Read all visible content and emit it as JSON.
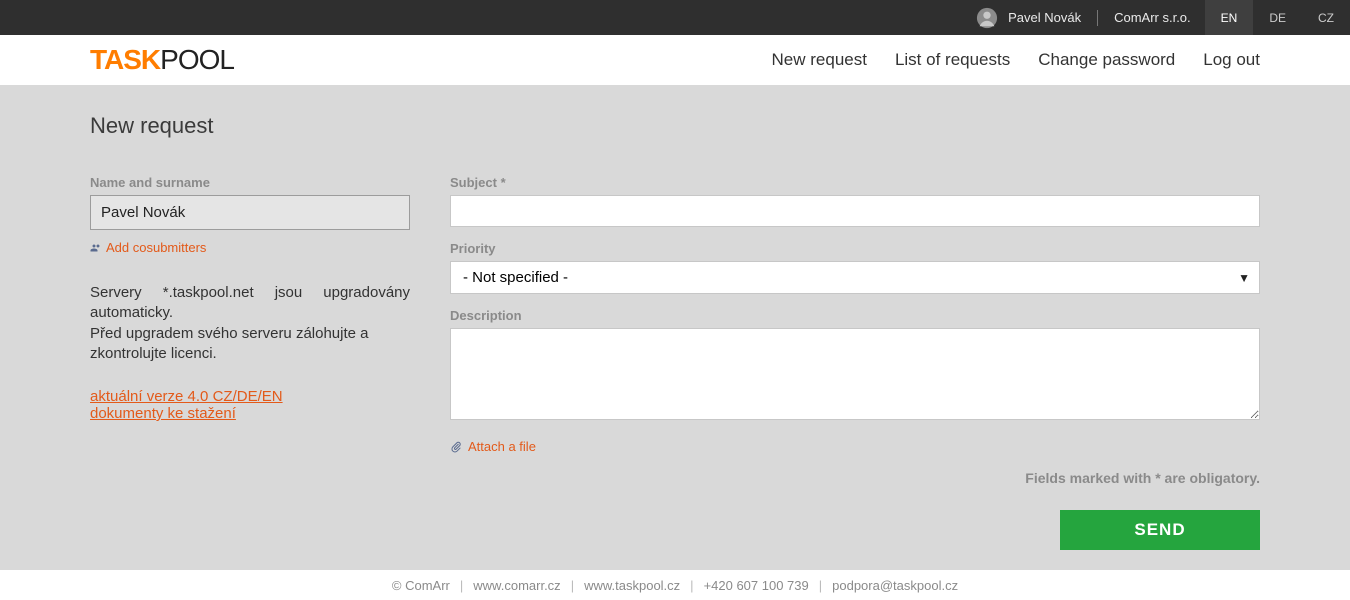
{
  "topbar": {
    "user_name": "Pavel Novák",
    "company": "ComArr s.r.o.",
    "langs": [
      "EN",
      "DE",
      "CZ"
    ],
    "active_lang": "EN"
  },
  "logo": {
    "part1": "TASK",
    "part2": "POOL"
  },
  "nav": {
    "new_request": "New request",
    "list_requests": "List of requests",
    "change_password": "Change password",
    "log_out": "Log out"
  },
  "page": {
    "title": "New request"
  },
  "form": {
    "name_label": "Name and surname",
    "name_value": "Pavel Novák",
    "add_cosubmitters": "Add cosubmitters",
    "info_line1": "Servery *.taskpool.net jsou upgradovány automaticky.",
    "info_line2": "Před upgradem svého serveru zálohujte a zkontrolujte licenci.",
    "info_link1": "aktuální verze 4.0 CZ/DE/EN",
    "info_link2": "dokumenty ke stažení",
    "subject_label": "Subject *",
    "subject_value": "",
    "priority_label": "Priority",
    "priority_value": "- Not specified -",
    "description_label": "Description",
    "description_value": "",
    "attach_label": "Attach a file",
    "obligatory_note": "Fields marked with * are obligatory.",
    "send_label": "SEND"
  },
  "footer": {
    "copyright": "© ComArr",
    "link1": "www.comarr.cz",
    "link2": "www.taskpool.cz",
    "phone": "+420 607 100 739",
    "email": "podpora@taskpool.cz"
  }
}
